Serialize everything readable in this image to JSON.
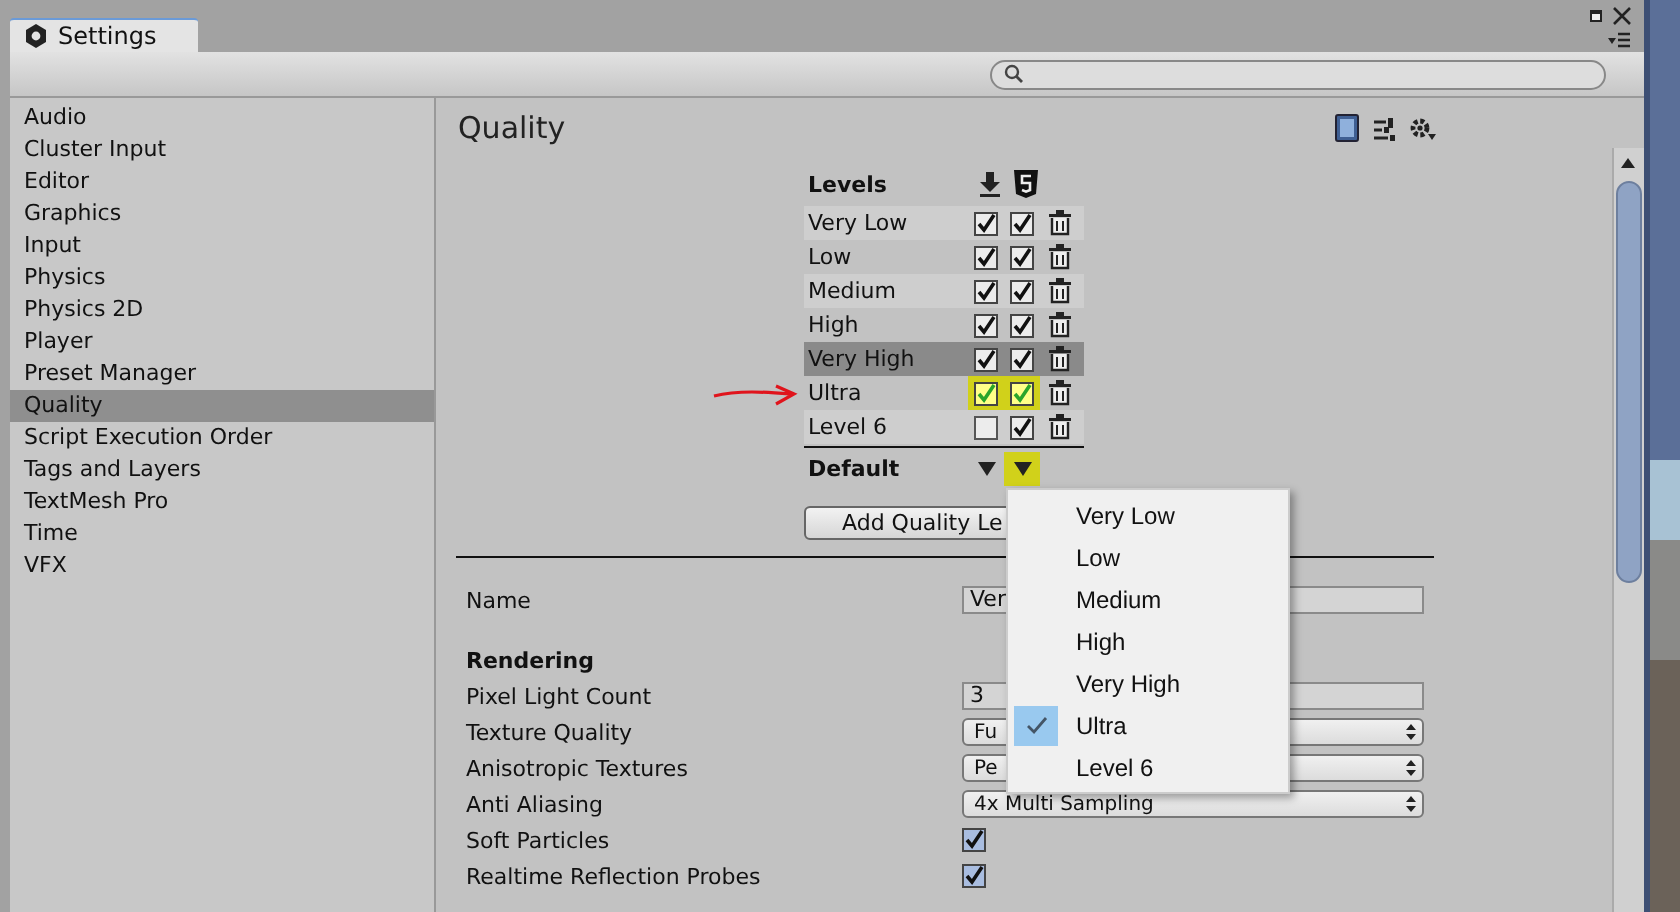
{
  "window": {
    "tab_title": "Settings"
  },
  "sidebar": {
    "items": [
      {
        "label": "Audio",
        "selected": false
      },
      {
        "label": "Cluster Input",
        "selected": false
      },
      {
        "label": "Editor",
        "selected": false
      },
      {
        "label": "Graphics",
        "selected": false
      },
      {
        "label": "Input",
        "selected": false
      },
      {
        "label": "Physics",
        "selected": false
      },
      {
        "label": "Physics 2D",
        "selected": false
      },
      {
        "label": "Player",
        "selected": false
      },
      {
        "label": "Preset Manager",
        "selected": false
      },
      {
        "label": "Quality",
        "selected": true
      },
      {
        "label": "Script Execution Order",
        "selected": false
      },
      {
        "label": "Tags and Layers",
        "selected": false
      },
      {
        "label": "TextMesh Pro",
        "selected": false
      },
      {
        "label": "Time",
        "selected": false
      },
      {
        "label": "VFX",
        "selected": false
      }
    ]
  },
  "page": {
    "title": "Quality"
  },
  "levels": {
    "heading": "Levels",
    "rows": [
      {
        "name": "Very Low",
        "platform_1": true,
        "platform_2": true,
        "selected": false,
        "highlighted": false
      },
      {
        "name": "Low",
        "platform_1": true,
        "platform_2": true,
        "selected": false,
        "highlighted": false
      },
      {
        "name": "Medium",
        "platform_1": true,
        "platform_2": true,
        "selected": false,
        "highlighted": false
      },
      {
        "name": "High",
        "platform_1": true,
        "platform_2": true,
        "selected": false,
        "highlighted": false
      },
      {
        "name": "Very High",
        "platform_1": true,
        "platform_2": true,
        "selected": true,
        "highlighted": false
      },
      {
        "name": "Ultra",
        "platform_1": true,
        "platform_2": true,
        "selected": false,
        "highlighted": true
      },
      {
        "name": "Level 6",
        "platform_1": false,
        "platform_2": true,
        "selected": false,
        "highlighted": false
      }
    ],
    "default_label": "Default",
    "defaults": [
      {
        "highlighted": false
      },
      {
        "highlighted": true
      }
    ]
  },
  "add_button": "Add Quality Le",
  "settings": [
    {
      "kind": "field",
      "label": "Name",
      "value": "Ver"
    },
    {
      "kind": "heading",
      "label": "Rendering"
    },
    {
      "kind": "field",
      "label": "Pixel Light Count",
      "value": "3"
    },
    {
      "kind": "dropdown",
      "label": "Texture Quality",
      "value": "Fu"
    },
    {
      "kind": "dropdown",
      "label": "Anisotropic Textures",
      "value": "Pe"
    },
    {
      "kind": "dropdown",
      "label": "Anti Aliasing",
      "value": "4x Multi Sampling"
    },
    {
      "kind": "checkbox",
      "label": "Soft Particles",
      "checked": true
    },
    {
      "kind": "checkbox",
      "label": "Realtime Reflection Probes",
      "checked": true
    }
  ],
  "menu": {
    "items": [
      {
        "label": "Very Low",
        "selected": false
      },
      {
        "label": "Low",
        "selected": false
      },
      {
        "label": "Medium",
        "selected": false
      },
      {
        "label": "High",
        "selected": false
      },
      {
        "label": "Very High",
        "selected": false
      },
      {
        "label": "Ultra",
        "selected": true
      },
      {
        "label": "Level 6",
        "selected": false
      }
    ]
  }
}
